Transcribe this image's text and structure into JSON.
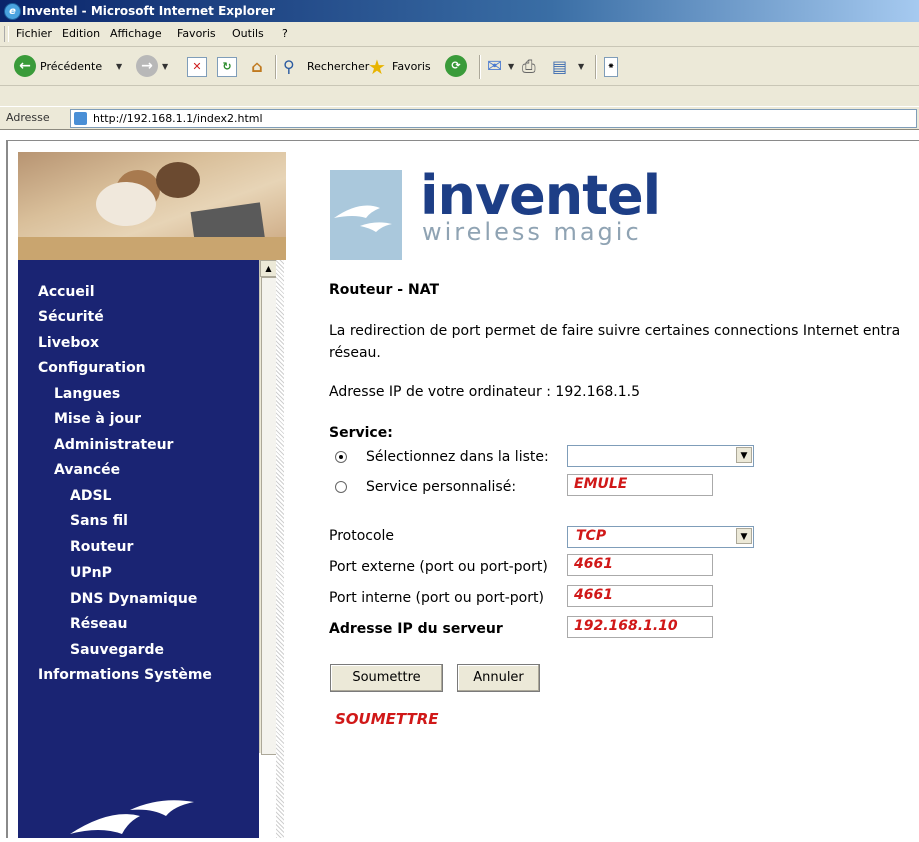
{
  "window": {
    "title": "Inventel - Microsoft Internet Explorer"
  },
  "menu": [
    "Fichier",
    "Edition",
    "Affichage",
    "Favoris",
    "Outils",
    "?"
  ],
  "toolbar": {
    "back_label": "Précédente",
    "search_label": "Rechercher",
    "favorites_label": "Favoris"
  },
  "address": {
    "label": "Adresse",
    "url": "http://192.168.1.1/index2.html"
  },
  "brand": {
    "name": "inventel",
    "tagline": "wireless magic"
  },
  "sidebar": {
    "items": [
      {
        "label": "Accueil"
      },
      {
        "label": "Sécurité"
      },
      {
        "label": "Livebox"
      },
      {
        "label": "Configuration"
      },
      {
        "label": "Langues"
      },
      {
        "label": "Mise à jour"
      },
      {
        "label": "Administrateur"
      },
      {
        "label": "Avancée"
      },
      {
        "label": "ADSL"
      },
      {
        "label": "Sans fil"
      },
      {
        "label": "Routeur"
      },
      {
        "label": "UPnP"
      },
      {
        "label": "DNS Dynamique"
      },
      {
        "label": "Réseau"
      },
      {
        "label": "Sauvegarde"
      },
      {
        "label": "Informations Système"
      }
    ]
  },
  "page": {
    "title": "Routeur - NAT",
    "intro": "La redirection de port permet de faire suivre certaines connections Internet entra réseau.",
    "ip_label": "Adresse IP de votre ordinateur : 192.168.1.5"
  },
  "form": {
    "service_heading": "Service:",
    "select_list_label": "Sélectionnez dans la liste:",
    "select_list_value": "",
    "custom_label": "Service personnalisé:",
    "custom_value": "EMULE",
    "protocol_label": "Protocole",
    "protocol_value": "TCP",
    "ext_port_label": "Port externe (port ou port-port)",
    "ext_port_value": "4661",
    "int_port_label": "Port interne (port ou port-port)",
    "int_port_value": "4661",
    "server_ip_label": "Adresse IP du serveur",
    "server_ip_value": "192.168.1.10",
    "submit_label": "Soumettre",
    "cancel_label": "Annuler"
  },
  "annotation": "SOUMETTRE",
  "colors": {
    "sidebar_bg": "#1a2473",
    "annotation_red": "#d01818",
    "brand_blue": "#1d3e86"
  }
}
